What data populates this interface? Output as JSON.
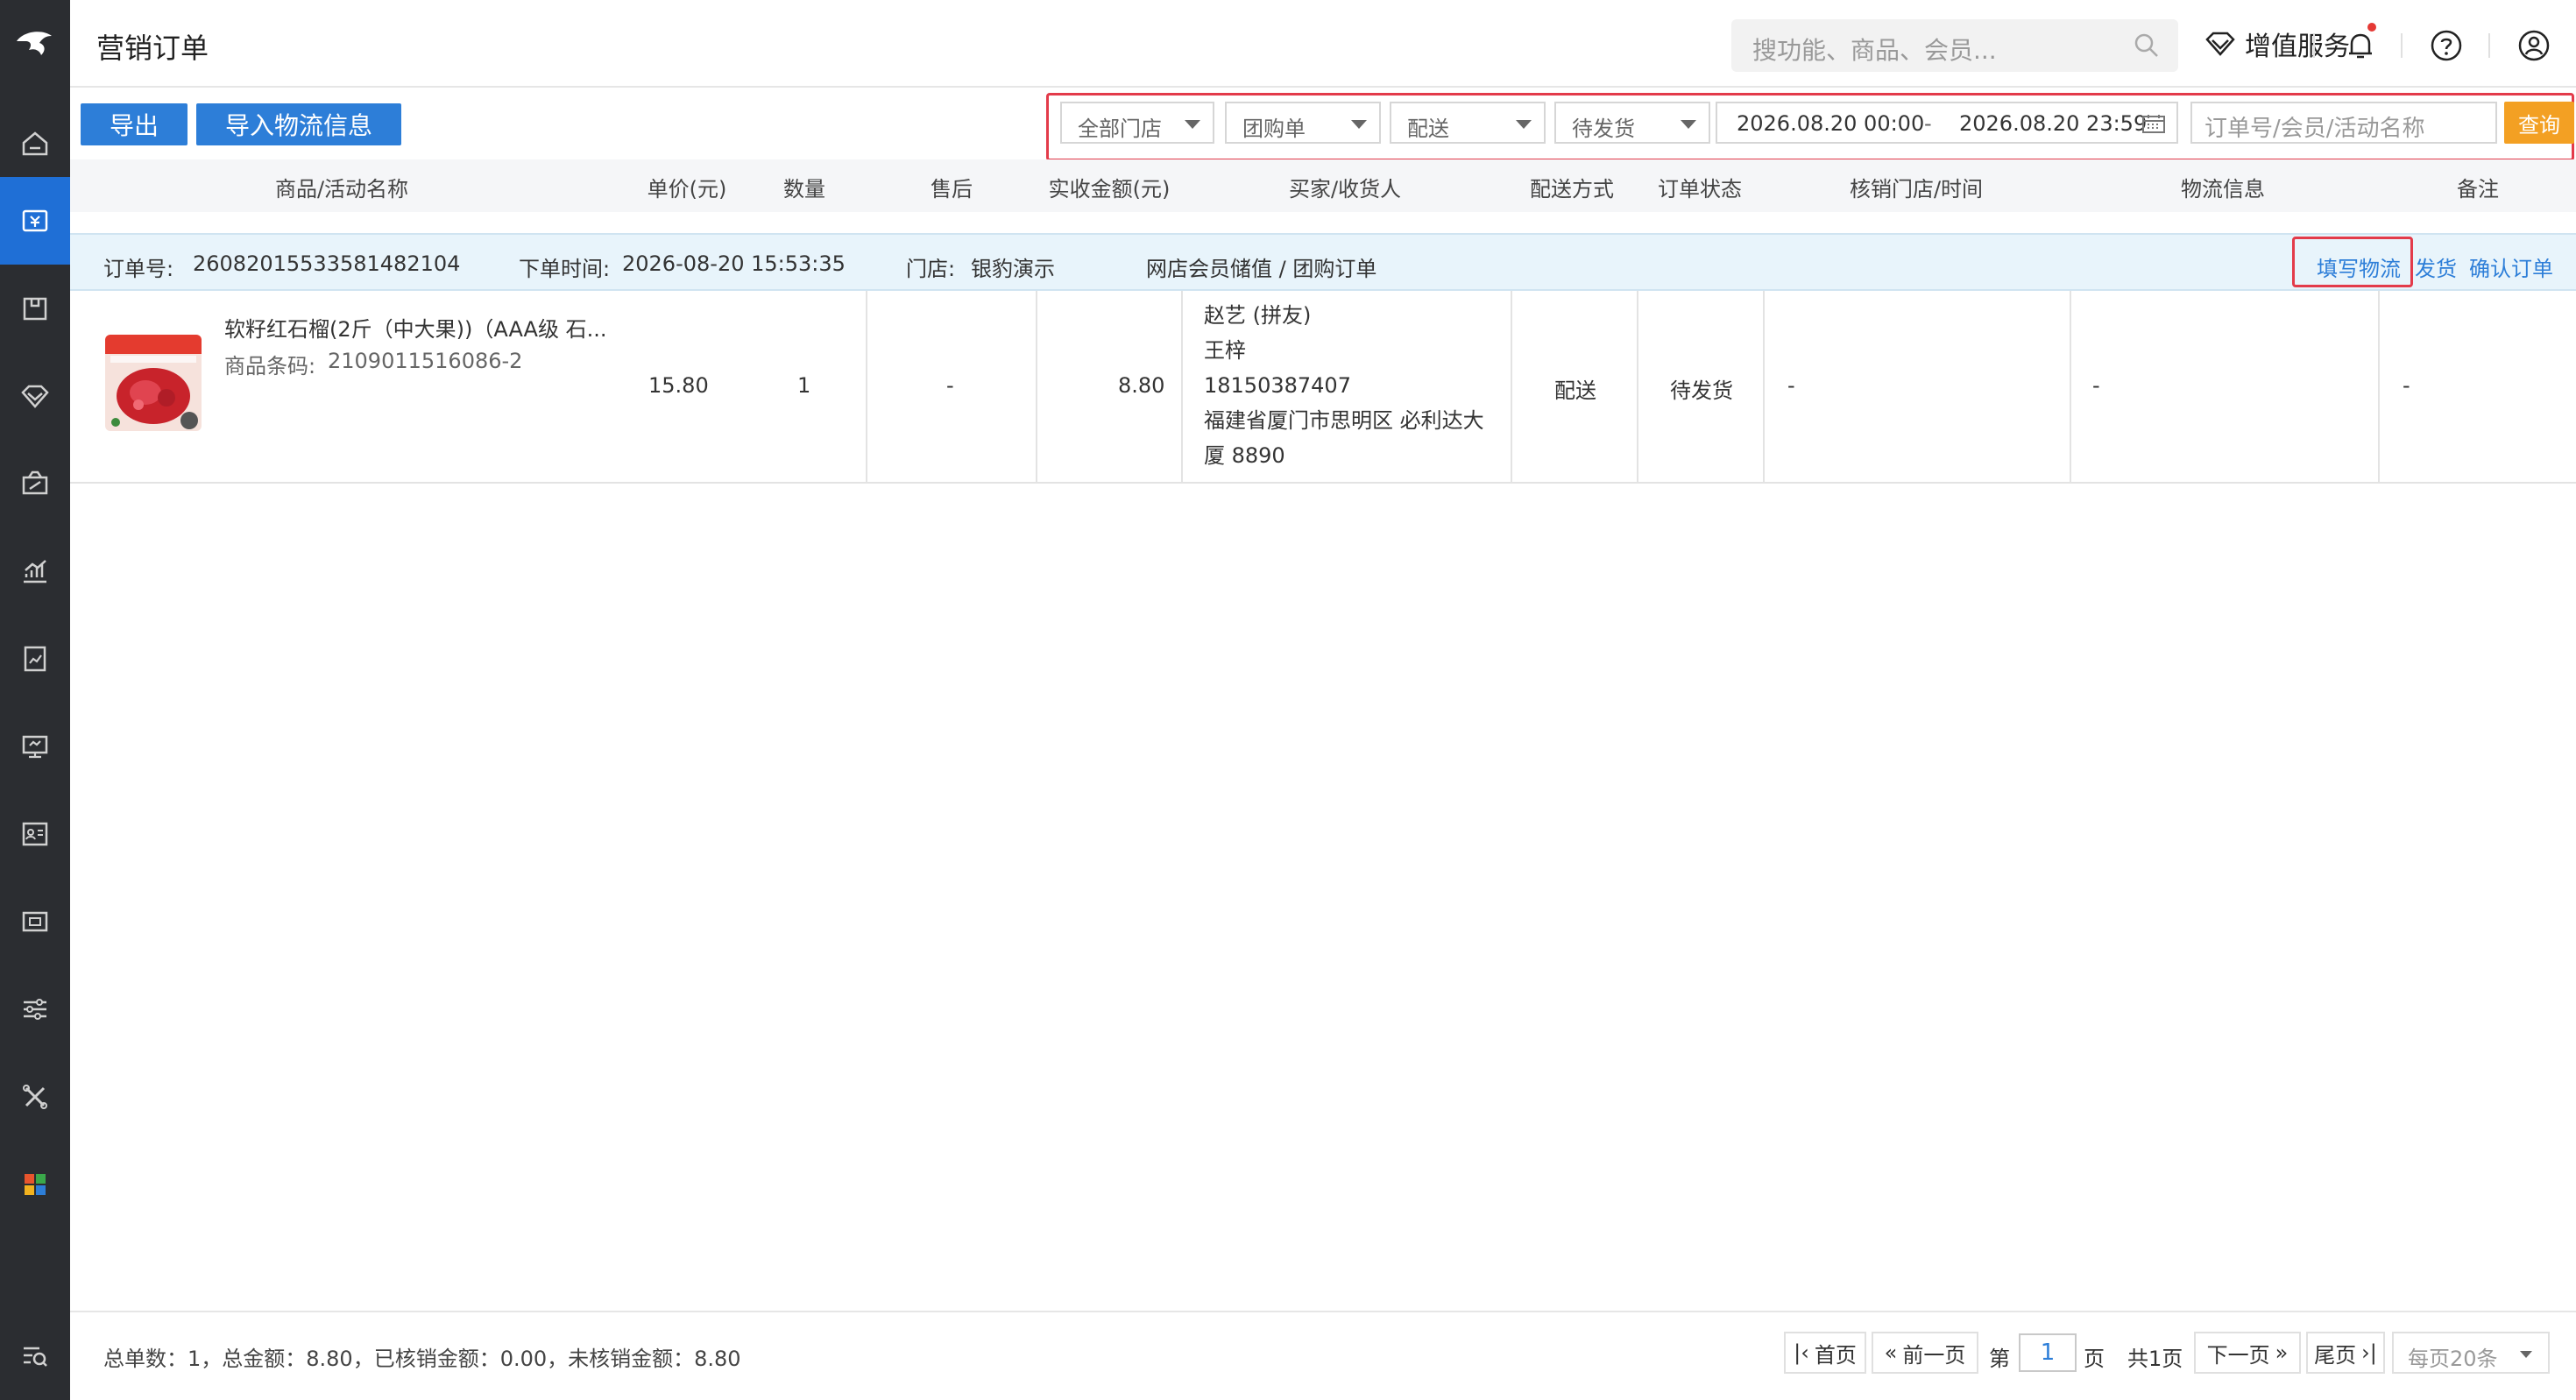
{
  "app": {
    "page_title": "营销订单",
    "global_search_placeholder": "搜功能、商品、会员...",
    "value_added_label": "增值服务"
  },
  "sidebar": {
    "items": [
      {
        "icon": "home-icon",
        "active": false
      },
      {
        "icon": "order-icon",
        "active": true
      },
      {
        "icon": "goods-icon",
        "active": false
      },
      {
        "icon": "member-icon",
        "active": false
      },
      {
        "icon": "marketing-icon",
        "active": false
      },
      {
        "icon": "statistics-icon",
        "active": false
      },
      {
        "icon": "report-icon",
        "active": false
      },
      {
        "icon": "finance-icon",
        "active": false
      },
      {
        "icon": "staff-icon",
        "active": false
      },
      {
        "icon": "device-icon",
        "active": false
      },
      {
        "icon": "settings-icon",
        "active": false
      },
      {
        "icon": "tools-icon",
        "active": false
      },
      {
        "icon": "apps-icon",
        "active": false
      },
      {
        "icon": "search-menu-icon",
        "active": false
      }
    ]
  },
  "toolbar": {
    "export_label": "导出",
    "import_logistics_label": "导入物流信息"
  },
  "filters": {
    "store": "全部门店",
    "order_type": "团购单",
    "delivery": "配送",
    "status": "待发货",
    "date_start": "2026.08.20 00:00",
    "date_separator": "-",
    "date_end": "2026.08.20 23:59",
    "search_placeholder": "订单号/会员/活动名称",
    "query_label": "查询"
  },
  "table": {
    "columns": [
      "商品/活动名称",
      "单价(元)",
      "数量",
      "售后",
      "实收金额(元)",
      "买家/收货人",
      "配送方式",
      "订单状态",
      "核销门店/时间",
      "物流信息",
      "备注"
    ]
  },
  "order": {
    "order_no_label": "订单号:",
    "order_no": "26082015533581482104",
    "order_time_label": "下单时间:",
    "order_time": "2026-08-20 15:53:35",
    "store_label": "门店:",
    "store": "银豹演示",
    "channel": "网店会员储值 / 团购订单",
    "actions": {
      "fill_logistics": "填写物流",
      "ship": "发货",
      "confirm": "确认订单"
    },
    "item": {
      "name": "软籽红石榴(2斤（中大果))（AAA级 石...",
      "barcode_label": "商品条码:",
      "barcode": "2109011516086-2",
      "unit_price": "15.80",
      "quantity": "1",
      "after_sale": "-",
      "paid_amount": "8.80",
      "buyer_name": "赵艺 (拼友)",
      "receiver": "王梓",
      "phone": "18150387407",
      "address_line1": "福建省厦门市思明区 必利达大",
      "address_line2": "厦 8890",
      "delivery_method": "配送",
      "status": "待发货",
      "verify_store_time": "-",
      "logistics": "-",
      "remark": "-"
    }
  },
  "footer": {
    "summary": "总单数：1，总金额：8.80，已核销金额：0.00，未核销金额：8.80",
    "first_page": "首页",
    "prev_page": "前一页",
    "page_prefix": "第",
    "current_page": "1",
    "page_suffix": "页",
    "total_pages": "共1页",
    "next_page": "下一页",
    "last_page": "尾页",
    "per_page": "每页20条"
  },
  "colors": {
    "sidebar_bg": "#2b2d31",
    "active_blue": "#1f6fd6",
    "button_blue": "#2d7ed8",
    "query_orange": "#f3a023",
    "highlight_red": "#e33b4a",
    "order_head_bg": "#e8f4fb"
  }
}
